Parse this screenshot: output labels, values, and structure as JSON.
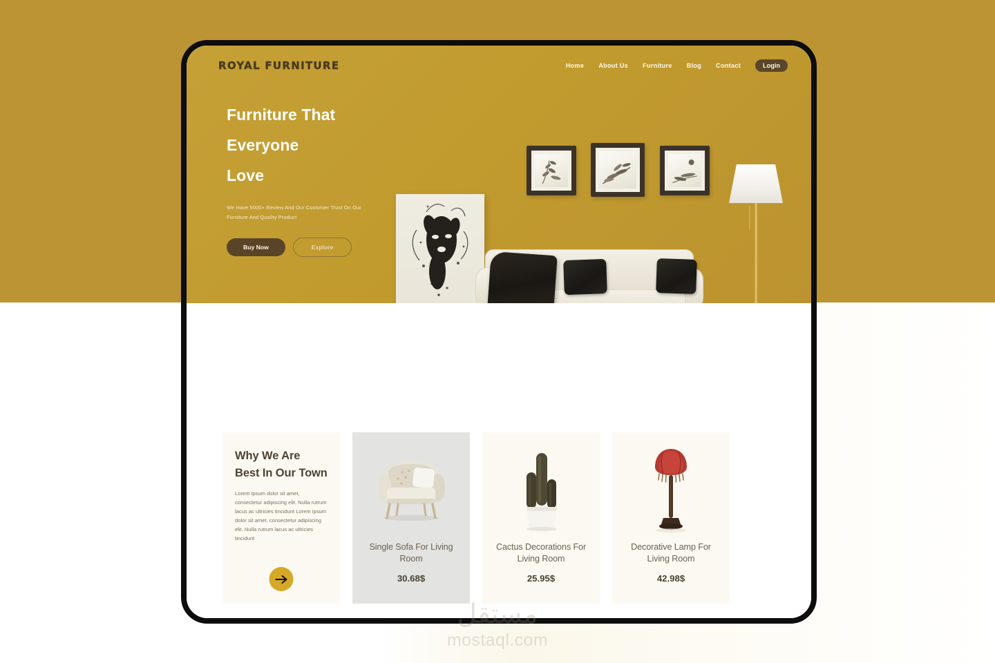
{
  "brand": {
    "name": "ROYAL FURNITURE"
  },
  "nav": {
    "items": [
      {
        "label": "Home"
      },
      {
        "label": "About Us"
      },
      {
        "label": "Furniture"
      },
      {
        "label": "Blog"
      },
      {
        "label": "Contact"
      }
    ],
    "login_label": "Login"
  },
  "hero": {
    "headline_lines": [
      "Furniture That",
      "Everyone",
      "Love"
    ],
    "subtext": "We Have 5000+ Review And Our Customer Trust On Our Furniture And Quality Product",
    "primary_button": "Buy Now",
    "secondary_button": "Explore"
  },
  "why_card": {
    "title": "Why We Are Best In Our Town",
    "body": "Lorem ipsum dolor sit amet, consectetur adipiscing elit. Nulla rutrum lacus ac ultricies tincidunt Lorem ipsum dolor sit amet, consectetur adipiscing elit. Nulla rutrum lacus ac ultricies tincidunt",
    "arrow_icon": "arrow-right-icon"
  },
  "products": [
    {
      "title": "Single Sofa For Living Room",
      "price": "30.68$",
      "image": "armchair-image",
      "selected": true
    },
    {
      "title": "Cactus Decorations For Living Room",
      "price": "25.95$",
      "image": "cactus-plant-image",
      "selected": false
    },
    {
      "title": "Decorative Lamp For Living Room",
      "price": "42.98$",
      "image": "decorative-lamp-image",
      "selected": false
    }
  ],
  "watermark": {
    "arabic": "مستقل",
    "domain": "mostaql.com"
  },
  "colors": {
    "gold_outer": "#bc9433",
    "gold_hero": "#c19b2e",
    "brown_dark": "#5a4428",
    "accent_yellow": "#d6a827",
    "card_cream": "#fbf9f2",
    "card_selected": "#e3e3e1"
  }
}
